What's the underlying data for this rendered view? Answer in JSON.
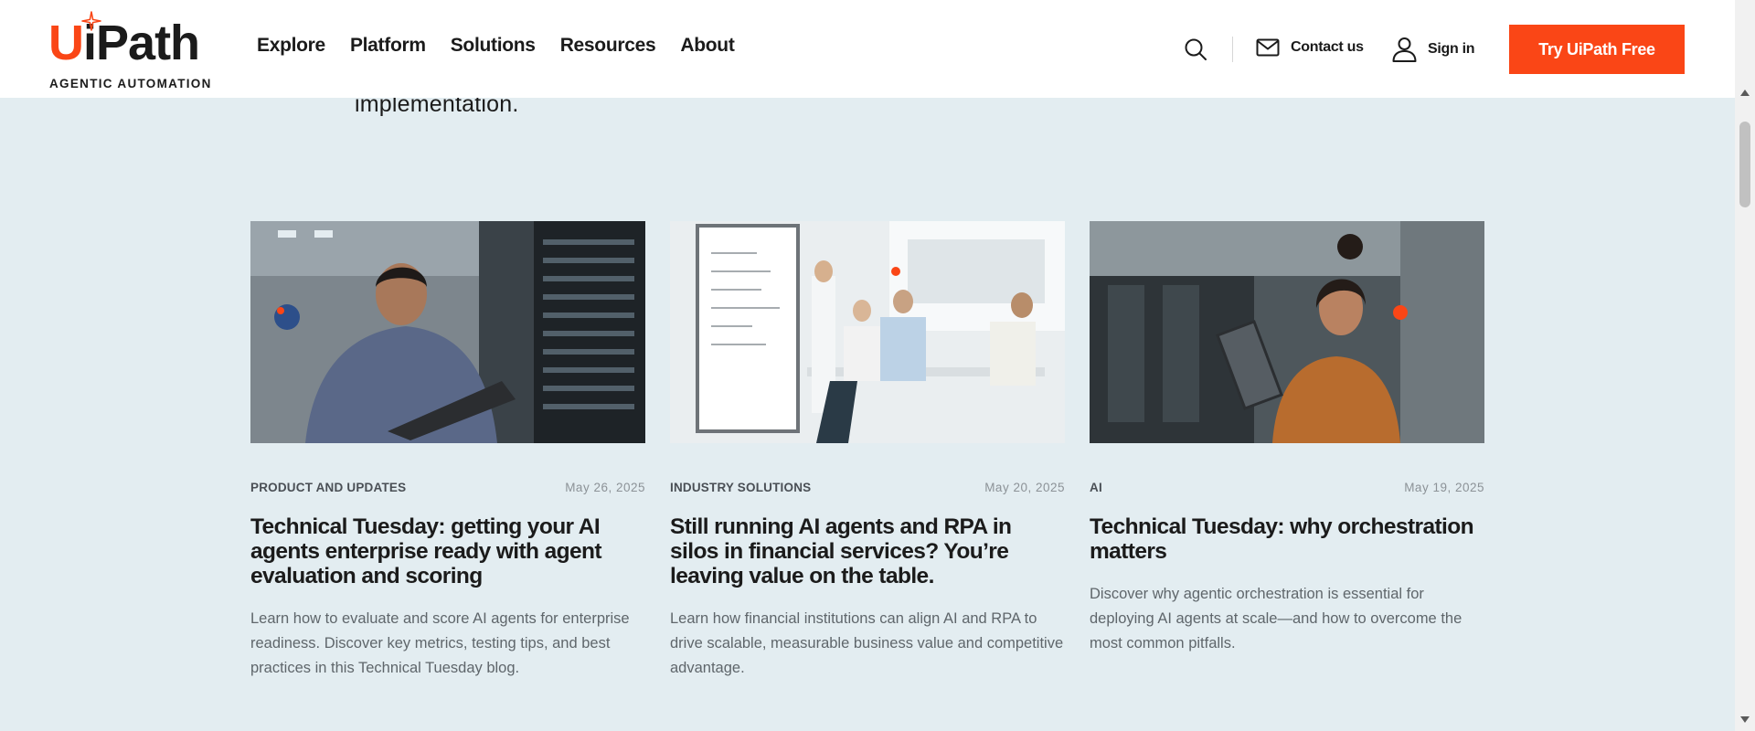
{
  "header": {
    "logo_text": "UiPath",
    "logo_tagline": "AGENTIC AUTOMATION",
    "nav": [
      "Explore",
      "Platform",
      "Solutions",
      "Resources",
      "About"
    ],
    "contact_label": "Contact us",
    "signin_label": "Sign in",
    "cta_label": "Try UiPath Free"
  },
  "intro": {
    "tail_text": "implementation."
  },
  "cards": [
    {
      "category": "PRODUCT AND UPDATES",
      "date": "May 26, 2025",
      "title": "Technical Tuesday: getting your AI agents enterprise ready with agent evaluation and scoring",
      "description": "Learn how to evaluate and score AI agents for enterprise readiness. Discover key metrics, testing tips, and best practices in this Technical Tuesday blog.",
      "image": "man-laptop-server-room"
    },
    {
      "category": "INDUSTRY SOLUTIONS",
      "date": "May 20, 2025",
      "title": "Still running AI agents and RPA in silos in financial services? You’re leaving value on the table.",
      "description": "Learn how financial institutions can align AI and RPA to drive scalable, measurable business value and competitive advantage.",
      "image": "office-meeting-whiteboard"
    },
    {
      "category": "AI",
      "date": "May 19, 2025",
      "title": "Technical Tuesday: why orchestration matters",
      "description": "Discover why agentic orchestration is essential for deploying AI agents at scale—and how to overcome the most common pitfalls.",
      "image": "woman-tablet-office"
    }
  ],
  "colors": {
    "brand_orange": "#fa4616",
    "page_background": "#e3edf1",
    "text_dark": "#1b1b1b"
  }
}
